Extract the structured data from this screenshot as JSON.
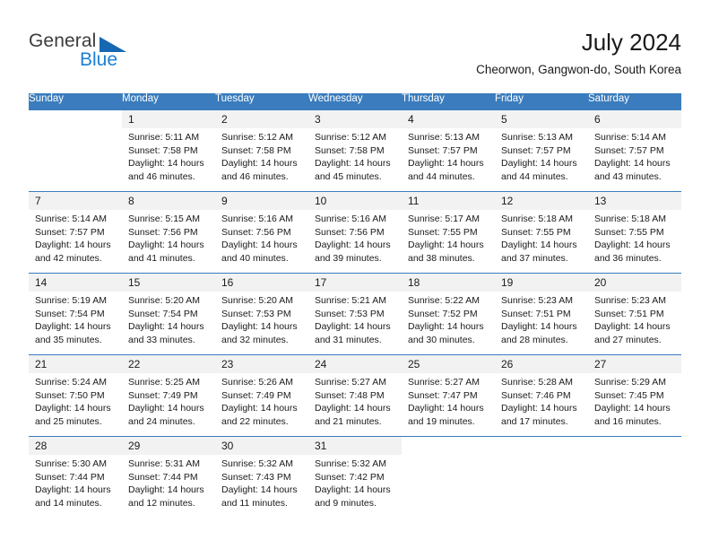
{
  "brand": {
    "name_top": "General",
    "name_bottom": "Blue",
    "triangle_color": "#1668b3",
    "blue_color": "#1b7fd4"
  },
  "header": {
    "title": "July 2024",
    "subtitle": "Cheorwon, Gangwon-do, South Korea"
  },
  "calendar": {
    "header_bg": "#3a7cbd",
    "daynum_bg": "#f2f2f2",
    "weekdays": [
      "Sunday",
      "Monday",
      "Tuesday",
      "Wednesday",
      "Thursday",
      "Friday",
      "Saturday"
    ],
    "weeks": [
      [
        {
          "day": "",
          "sunrise": "",
          "sunset": "",
          "daylight_line1": "",
          "daylight_line2": ""
        },
        {
          "day": "1",
          "sunrise": "Sunrise: 5:11 AM",
          "sunset": "Sunset: 7:58 PM",
          "daylight_line1": "Daylight: 14 hours",
          "daylight_line2": "and 46 minutes."
        },
        {
          "day": "2",
          "sunrise": "Sunrise: 5:12 AM",
          "sunset": "Sunset: 7:58 PM",
          "daylight_line1": "Daylight: 14 hours",
          "daylight_line2": "and 46 minutes."
        },
        {
          "day": "3",
          "sunrise": "Sunrise: 5:12 AM",
          "sunset": "Sunset: 7:58 PM",
          "daylight_line1": "Daylight: 14 hours",
          "daylight_line2": "and 45 minutes."
        },
        {
          "day": "4",
          "sunrise": "Sunrise: 5:13 AM",
          "sunset": "Sunset: 7:57 PM",
          "daylight_line1": "Daylight: 14 hours",
          "daylight_line2": "and 44 minutes."
        },
        {
          "day": "5",
          "sunrise": "Sunrise: 5:13 AM",
          "sunset": "Sunset: 7:57 PM",
          "daylight_line1": "Daylight: 14 hours",
          "daylight_line2": "and 44 minutes."
        },
        {
          "day": "6",
          "sunrise": "Sunrise: 5:14 AM",
          "sunset": "Sunset: 7:57 PM",
          "daylight_line1": "Daylight: 14 hours",
          "daylight_line2": "and 43 minutes."
        }
      ],
      [
        {
          "day": "7",
          "sunrise": "Sunrise: 5:14 AM",
          "sunset": "Sunset: 7:57 PM",
          "daylight_line1": "Daylight: 14 hours",
          "daylight_line2": "and 42 minutes."
        },
        {
          "day": "8",
          "sunrise": "Sunrise: 5:15 AM",
          "sunset": "Sunset: 7:56 PM",
          "daylight_line1": "Daylight: 14 hours",
          "daylight_line2": "and 41 minutes."
        },
        {
          "day": "9",
          "sunrise": "Sunrise: 5:16 AM",
          "sunset": "Sunset: 7:56 PM",
          "daylight_line1": "Daylight: 14 hours",
          "daylight_line2": "and 40 minutes."
        },
        {
          "day": "10",
          "sunrise": "Sunrise: 5:16 AM",
          "sunset": "Sunset: 7:56 PM",
          "daylight_line1": "Daylight: 14 hours",
          "daylight_line2": "and 39 minutes."
        },
        {
          "day": "11",
          "sunrise": "Sunrise: 5:17 AM",
          "sunset": "Sunset: 7:55 PM",
          "daylight_line1": "Daylight: 14 hours",
          "daylight_line2": "and 38 minutes."
        },
        {
          "day": "12",
          "sunrise": "Sunrise: 5:18 AM",
          "sunset": "Sunset: 7:55 PM",
          "daylight_line1": "Daylight: 14 hours",
          "daylight_line2": "and 37 minutes."
        },
        {
          "day": "13",
          "sunrise": "Sunrise: 5:18 AM",
          "sunset": "Sunset: 7:55 PM",
          "daylight_line1": "Daylight: 14 hours",
          "daylight_line2": "and 36 minutes."
        }
      ],
      [
        {
          "day": "14",
          "sunrise": "Sunrise: 5:19 AM",
          "sunset": "Sunset: 7:54 PM",
          "daylight_line1": "Daylight: 14 hours",
          "daylight_line2": "and 35 minutes."
        },
        {
          "day": "15",
          "sunrise": "Sunrise: 5:20 AM",
          "sunset": "Sunset: 7:54 PM",
          "daylight_line1": "Daylight: 14 hours",
          "daylight_line2": "and 33 minutes."
        },
        {
          "day": "16",
          "sunrise": "Sunrise: 5:20 AM",
          "sunset": "Sunset: 7:53 PM",
          "daylight_line1": "Daylight: 14 hours",
          "daylight_line2": "and 32 minutes."
        },
        {
          "day": "17",
          "sunrise": "Sunrise: 5:21 AM",
          "sunset": "Sunset: 7:53 PM",
          "daylight_line1": "Daylight: 14 hours",
          "daylight_line2": "and 31 minutes."
        },
        {
          "day": "18",
          "sunrise": "Sunrise: 5:22 AM",
          "sunset": "Sunset: 7:52 PM",
          "daylight_line1": "Daylight: 14 hours",
          "daylight_line2": "and 30 minutes."
        },
        {
          "day": "19",
          "sunrise": "Sunrise: 5:23 AM",
          "sunset": "Sunset: 7:51 PM",
          "daylight_line1": "Daylight: 14 hours",
          "daylight_line2": "and 28 minutes."
        },
        {
          "day": "20",
          "sunrise": "Sunrise: 5:23 AM",
          "sunset": "Sunset: 7:51 PM",
          "daylight_line1": "Daylight: 14 hours",
          "daylight_line2": "and 27 minutes."
        }
      ],
      [
        {
          "day": "21",
          "sunrise": "Sunrise: 5:24 AM",
          "sunset": "Sunset: 7:50 PM",
          "daylight_line1": "Daylight: 14 hours",
          "daylight_line2": "and 25 minutes."
        },
        {
          "day": "22",
          "sunrise": "Sunrise: 5:25 AM",
          "sunset": "Sunset: 7:49 PM",
          "daylight_line1": "Daylight: 14 hours",
          "daylight_line2": "and 24 minutes."
        },
        {
          "day": "23",
          "sunrise": "Sunrise: 5:26 AM",
          "sunset": "Sunset: 7:49 PM",
          "daylight_line1": "Daylight: 14 hours",
          "daylight_line2": "and 22 minutes."
        },
        {
          "day": "24",
          "sunrise": "Sunrise: 5:27 AM",
          "sunset": "Sunset: 7:48 PM",
          "daylight_line1": "Daylight: 14 hours",
          "daylight_line2": "and 21 minutes."
        },
        {
          "day": "25",
          "sunrise": "Sunrise: 5:27 AM",
          "sunset": "Sunset: 7:47 PM",
          "daylight_line1": "Daylight: 14 hours",
          "daylight_line2": "and 19 minutes."
        },
        {
          "day": "26",
          "sunrise": "Sunrise: 5:28 AM",
          "sunset": "Sunset: 7:46 PM",
          "daylight_line1": "Daylight: 14 hours",
          "daylight_line2": "and 17 minutes."
        },
        {
          "day": "27",
          "sunrise": "Sunrise: 5:29 AM",
          "sunset": "Sunset: 7:45 PM",
          "daylight_line1": "Daylight: 14 hours",
          "daylight_line2": "and 16 minutes."
        }
      ],
      [
        {
          "day": "28",
          "sunrise": "Sunrise: 5:30 AM",
          "sunset": "Sunset: 7:44 PM",
          "daylight_line1": "Daylight: 14 hours",
          "daylight_line2": "and 14 minutes."
        },
        {
          "day": "29",
          "sunrise": "Sunrise: 5:31 AM",
          "sunset": "Sunset: 7:44 PM",
          "daylight_line1": "Daylight: 14 hours",
          "daylight_line2": "and 12 minutes."
        },
        {
          "day": "30",
          "sunrise": "Sunrise: 5:32 AM",
          "sunset": "Sunset: 7:43 PM",
          "daylight_line1": "Daylight: 14 hours",
          "daylight_line2": "and 11 minutes."
        },
        {
          "day": "31",
          "sunrise": "Sunrise: 5:32 AM",
          "sunset": "Sunset: 7:42 PM",
          "daylight_line1": "Daylight: 14 hours",
          "daylight_line2": "and 9 minutes."
        },
        {
          "day": "",
          "sunrise": "",
          "sunset": "",
          "daylight_line1": "",
          "daylight_line2": ""
        },
        {
          "day": "",
          "sunrise": "",
          "sunset": "",
          "daylight_line1": "",
          "daylight_line2": ""
        },
        {
          "day": "",
          "sunrise": "",
          "sunset": "",
          "daylight_line1": "",
          "daylight_line2": ""
        }
      ]
    ]
  }
}
